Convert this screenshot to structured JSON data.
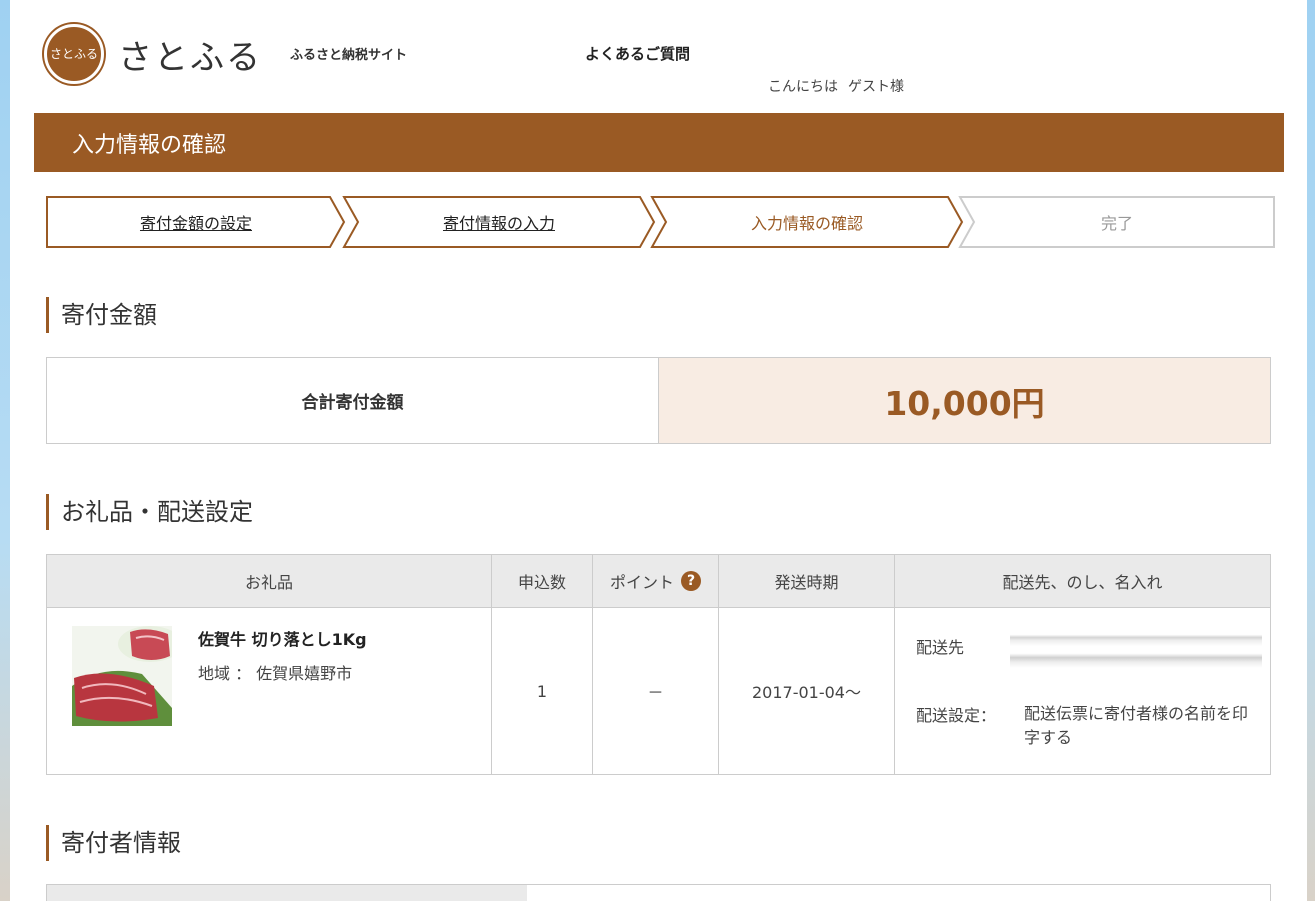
{
  "header": {
    "logo_mark": "さとふる",
    "logo_text": "さとふる",
    "tagline": "ふるさと納税サイト",
    "faq": "よくあるご質問",
    "greeting": "こんにちは",
    "user": "ゲスト様"
  },
  "page_title": "入力情報の確認",
  "steps": [
    {
      "label": "寄付金額の設定",
      "state": "done"
    },
    {
      "label": "寄付情報の入力",
      "state": "done"
    },
    {
      "label": "入力情報の確認",
      "state": "current"
    },
    {
      "label": "完了",
      "state": "future"
    }
  ],
  "sections": {
    "amount": "寄付金額",
    "gift": "お礼品・配送設定",
    "donor": "寄付者情報"
  },
  "amount_table": {
    "label": "合計寄付金額",
    "value": "10,000円"
  },
  "gift_table": {
    "headers": [
      "お礼品",
      "申込数",
      "ポイント",
      "発送時期",
      "配送先、のし、名入れ"
    ],
    "help_icon": "?",
    "row": {
      "name": "佐賀牛 切り落とし1Kg",
      "region": "地域 ： 佐賀県嬉野市",
      "quantity": "1",
      "points": "－",
      "ship_date": "2017-01-04～",
      "ship_to_label": "配送先",
      "ship_setting_label": "配送設定：",
      "ship_setting_value": "配送伝票に寄付者様の名前を印字する"
    }
  },
  "colors": {
    "brand": "#9a5a24",
    "amount_bg": "#f8ece3",
    "header_bg": "#eaeaea"
  }
}
